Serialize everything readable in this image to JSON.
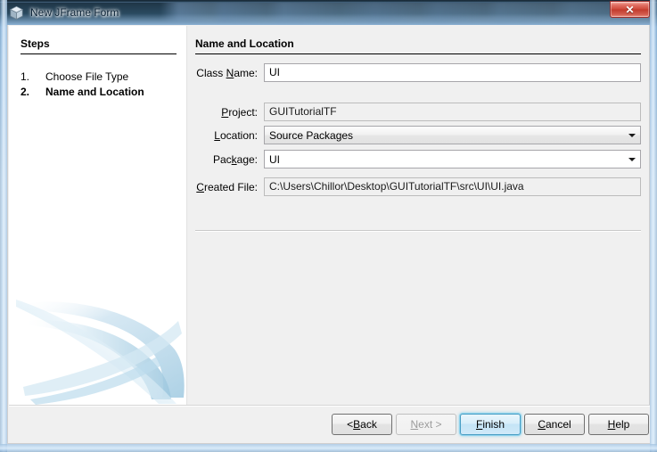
{
  "window": {
    "title": "New JFrame Form",
    "icon": "jframe-cube-icon",
    "close_label": "✕"
  },
  "steps_panel": {
    "heading": "Steps",
    "items": [
      {
        "number": "1.",
        "label": "Choose File Type",
        "active": false
      },
      {
        "number": "2.",
        "label": "Name and Location",
        "active": true
      }
    ]
  },
  "content": {
    "heading": "Name and Location",
    "fields": {
      "class_name": {
        "label_pre": "Class ",
        "label_mnemonic": "N",
        "label_post": "ame:",
        "value": "UI"
      },
      "project": {
        "label_pre": "",
        "label_mnemonic": "P",
        "label_post": "roject:",
        "value": "GUITutorialTF"
      },
      "location": {
        "label_pre": "",
        "label_mnemonic": "L",
        "label_post": "ocation:",
        "value": "Source Packages"
      },
      "package": {
        "label_pre": "Pac",
        "label_mnemonic": "k",
        "label_post": "age:",
        "value": "UI"
      },
      "created_file": {
        "label_pre": "",
        "label_mnemonic": "C",
        "label_post": "reated File:",
        "value": "C:\\Users\\Chillor\\Desktop\\GUITutorialTF\\src\\UI\\UI.java"
      }
    }
  },
  "buttons": {
    "back": {
      "pre": "< ",
      "mnemonic": "B",
      "post": "ack"
    },
    "next": {
      "pre": "",
      "mnemonic": "N",
      "post": "ext >"
    },
    "finish": {
      "pre": "",
      "mnemonic": "F",
      "post": "inish"
    },
    "cancel": {
      "pre": "",
      "mnemonic": "C",
      "post": "ancel"
    },
    "help": {
      "pre": "",
      "mnemonic": "H",
      "post": "elp"
    }
  },
  "colors": {
    "dialog_background": "#f0f0f0",
    "panel_white": "#ffffff",
    "default_button_border": "#4a9ec4",
    "close_button_red": "#cf4a3c",
    "swoosh_blue": "#bcd9ec"
  }
}
